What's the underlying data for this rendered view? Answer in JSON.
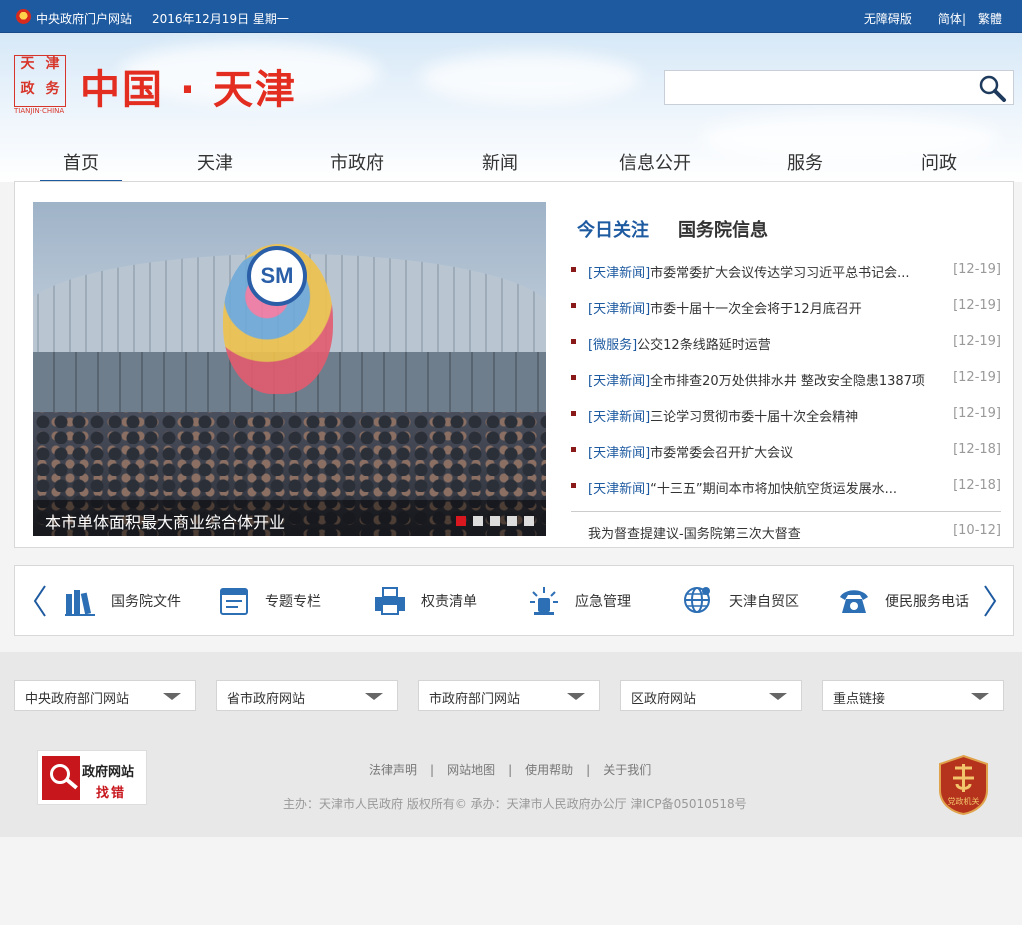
{
  "topbar": {
    "portal": "中央政府门户网站",
    "date": "2016年12月19日 星期一",
    "accessible": "无障碍版",
    "simplified": "简体",
    "separator": "|",
    "traditional": "繁體"
  },
  "header": {
    "seal_chars": [
      "天",
      "津",
      "政",
      "务"
    ],
    "logo_en": "TIANJIN·CHINA",
    "title": "中国 · 天津",
    "search_placeholder": ""
  },
  "nav": {
    "items": [
      "首页",
      "天津",
      "市政府",
      "新闻",
      "信息公开",
      "服务",
      "问政"
    ],
    "active_index": 0
  },
  "slider": {
    "sign_text": "SM",
    "caption": "本市单体面积最大商业综合体开业",
    "dots": 5,
    "active_dot": 0
  },
  "tabs": {
    "active": "今日关注",
    "inactive": "国务院信息"
  },
  "news": [
    {
      "cat": "[天津新闻]",
      "title": "市委常委扩大会议传达学习习近平总书记会...",
      "date": "[12-19]"
    },
    {
      "cat": "[天津新闻]",
      "title": "市委十届十一次全会将于12月底召开",
      "date": "[12-19]"
    },
    {
      "cat": "[微服务]",
      "title": "公交12条线路延时运营",
      "date": "[12-19]"
    },
    {
      "cat": "[天津新闻]",
      "title": "全市排查20万处供排水井 整改安全隐患1387项",
      "date": "[12-19]"
    },
    {
      "cat": "[天津新闻]",
      "title": "三论学习贯彻市委十届十次全会精神",
      "date": "[12-19]"
    },
    {
      "cat": "[天津新闻]",
      "title": "市委常委会召开扩大会议",
      "date": "[12-18]"
    },
    {
      "cat": "[天津新闻]",
      "title": "“十三五”期间本市将加快航空货运发展水...",
      "date": "[12-18]"
    }
  ],
  "news_extra": {
    "title": "我为督查提建议-国务院第三次大督查",
    "date": "[10-12]"
  },
  "quick_links": [
    {
      "label": "国务院文件",
      "icon": "books-icon"
    },
    {
      "label": "专题专栏",
      "icon": "window-icon"
    },
    {
      "label": "权责清单",
      "icon": "printer-icon"
    },
    {
      "label": "应急管理",
      "icon": "siren-icon"
    },
    {
      "label": "天津自贸区",
      "icon": "globe-icon"
    },
    {
      "label": "便民服务电话",
      "icon": "phone-icon"
    }
  ],
  "selects": [
    "中央政府部门网站",
    "省市政府网站",
    "市政府部门网站",
    "区政府网站",
    "重点链接"
  ],
  "footer": {
    "jiucuo_line1": "政府网站",
    "jiucuo_line2": "找错",
    "links": [
      "法律声明",
      "网站地图",
      "使用帮助",
      "关于我们"
    ],
    "link_separator": "|",
    "copyright": "主办：天津市人民政府 版权所有© 承办：天津市人民政府办公厅 津ICP备05010518号",
    "party_label": "党政机关"
  },
  "colors": {
    "primary": "#1e5aa0",
    "red": "#e32d20",
    "dot_active": "#d8171e"
  }
}
